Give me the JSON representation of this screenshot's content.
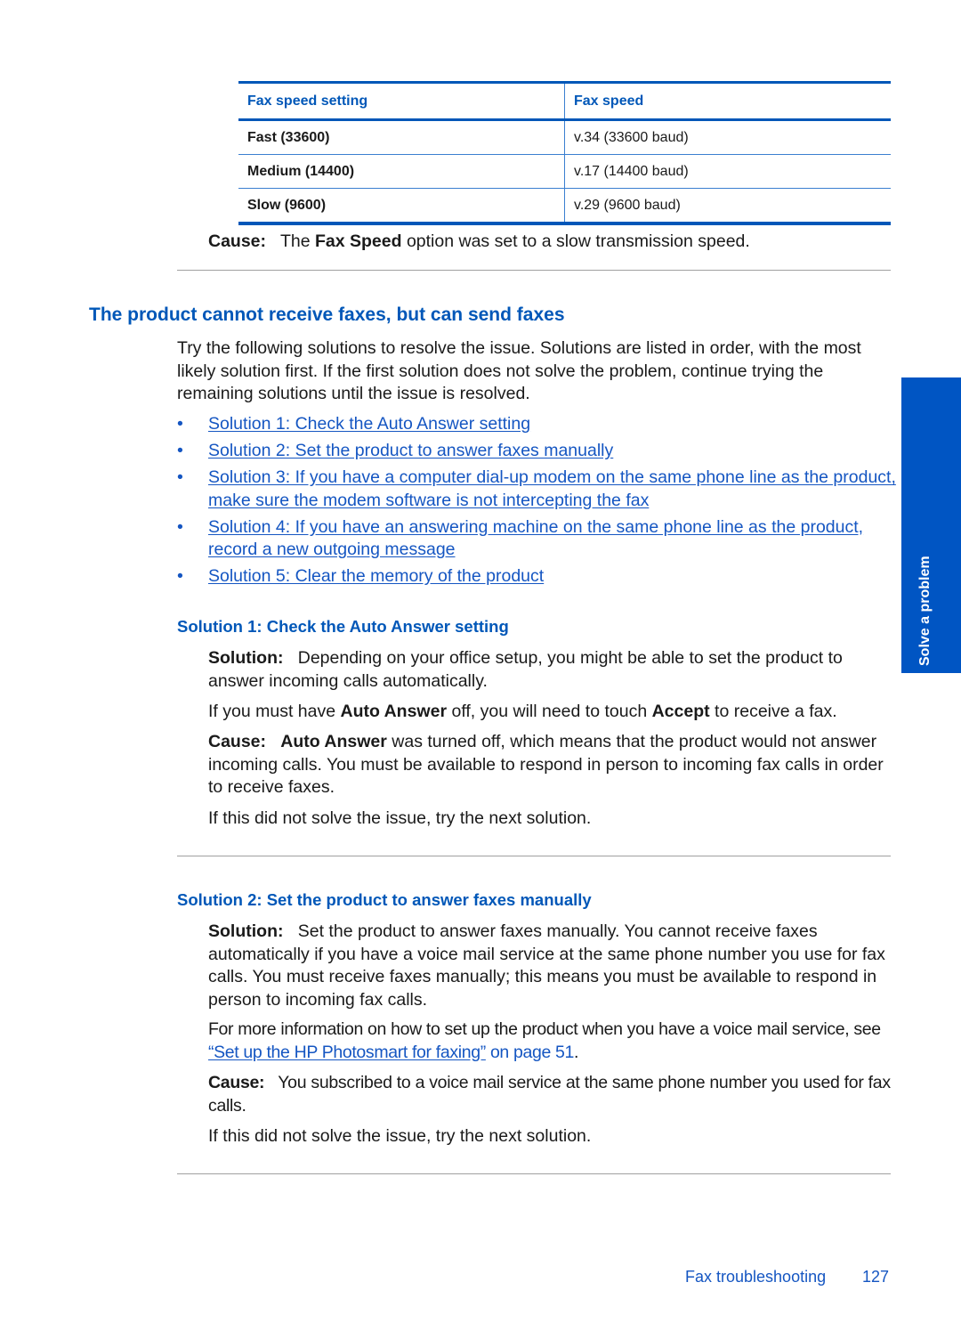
{
  "table": {
    "headers": [
      "Fax speed setting",
      "Fax speed"
    ],
    "rows": [
      [
        "Fast (33600)",
        "v.34 (33600 baud)"
      ],
      [
        "Medium (14400)",
        "v.17 (14400 baud)"
      ],
      [
        "Slow (9600)",
        "v.29 (9600 baud)"
      ]
    ]
  },
  "cause_top": {
    "label": "Cause:",
    "pre": "The",
    "bold": "Fax Speed",
    "post": "option was set to a slow transmission speed."
  },
  "section": {
    "title": "The product cannot receive faxes, but can send faxes",
    "intro": "Try the following solutions to resolve the issue. Solutions are listed in order, with the most likely solution first. If the first solution does not solve the problem, continue trying the remaining solutions until the issue is resolved.",
    "bullet": "•",
    "links": [
      "Solution 1: Check the Auto Answer setting",
      "Solution 2: Set the product to answer faxes manually",
      "Solution 3: If you have a computer dial-up modem on the same phone line as the product, make sure the modem software is not intercepting the fax",
      "Solution 4: If you have an answering machine on the same phone line as the product, record a new outgoing message",
      "Solution 5: Clear the memory of the product"
    ]
  },
  "solution1": {
    "title": "Solution 1: Check the Auto Answer setting",
    "solution_label": "Solution:",
    "solution_text": "Depending on your office setup, you might be able to set the product to answer incoming calls automatically.",
    "note_pre": "If you must have",
    "note_bold1": "Auto Answer",
    "note_mid": "off, you will need to touch",
    "note_bold2": "Accept",
    "note_post": "to receive a fax.",
    "cause_label": "Cause:",
    "cause_bold": "Auto Answer",
    "cause_text": "was turned off, which means that the product would not answer incoming calls. You must be available to respond in person to incoming fax calls in order to receive faxes.",
    "next": "If this did not solve the issue, try the next solution."
  },
  "solution2": {
    "title": "Solution 2: Set the product to answer faxes manually",
    "solution_label": "Solution:",
    "solution_text": "Set the product to answer faxes manually. You cannot receive faxes automatically if you have a voice mail service at the same phone number you use for fax calls. You must receive faxes manually; this means you must be available to respond in person to incoming fax calls.",
    "more_pre": "For more information on how to set up the product when you have a voice mail service, see",
    "more_link": "“Set up the HP Photosmart for faxing”",
    "more_page": "on page 51",
    "more_post": ".",
    "cause_label": "Cause:",
    "cause_text": "You subscribed to a voice mail service at the same phone number you used for fax calls.",
    "next": "If this did not solve the issue, try the next solution."
  },
  "side_tab": {
    "label": "Solve a problem",
    "color": "#0055c3"
  },
  "footer": {
    "section": "Fax troubleshooting",
    "page": "127"
  },
  "colors": {
    "accent": "#0057b8",
    "link": "#1556c2",
    "text": "#1a1a1a",
    "rule": "#a0a0a0"
  }
}
